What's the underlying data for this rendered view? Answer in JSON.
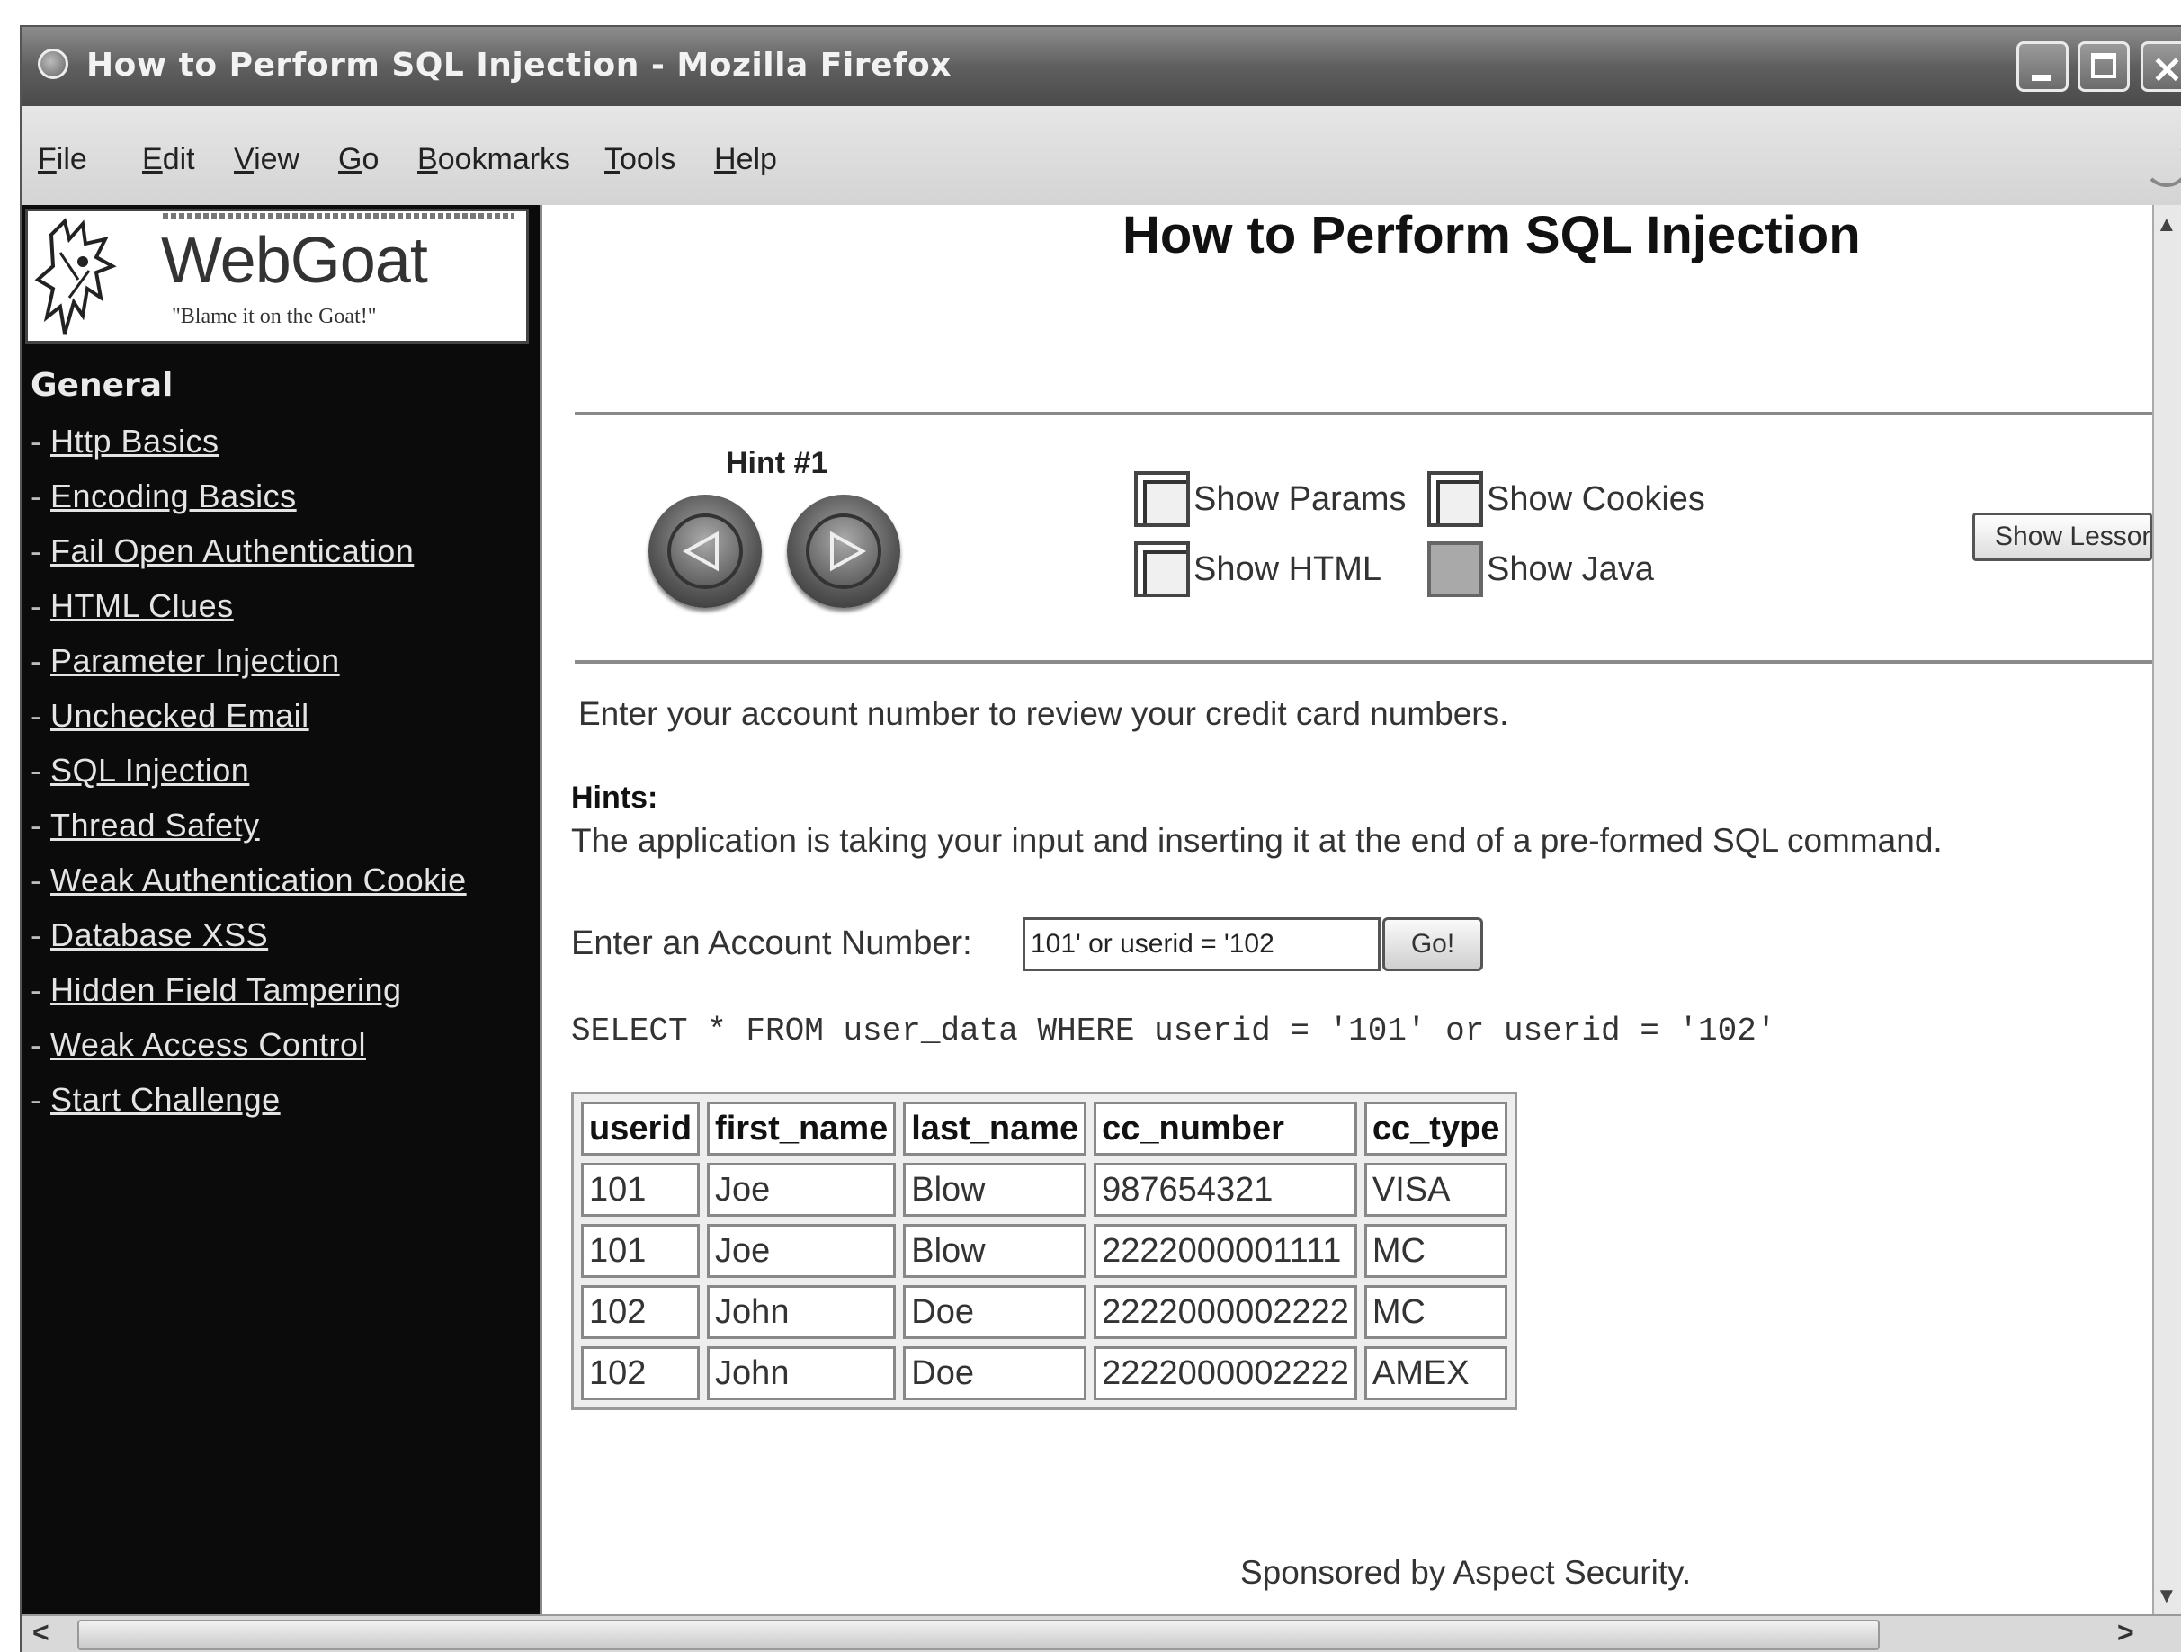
{
  "window": {
    "title": "How to Perform SQL Injection - Mozilla Firefox"
  },
  "menu": {
    "items": [
      {
        "first": "F",
        "rest": "ile"
      },
      {
        "first": "E",
        "rest": "dit"
      },
      {
        "first": "V",
        "rest": "iew"
      },
      {
        "first": "G",
        "rest": "o"
      },
      {
        "first": "B",
        "rest": "ookmarks"
      },
      {
        "first": "T",
        "rest": "ools"
      },
      {
        "first": "H",
        "rest": "elp"
      }
    ]
  },
  "logo": {
    "title": "WebGoat",
    "tagline": "\"Blame it on the Goat!\""
  },
  "sidebar": {
    "heading": "General",
    "items": [
      {
        "label": "Http Basics"
      },
      {
        "label": "Encoding Basics"
      },
      {
        "label": "Fail Open Authentication"
      },
      {
        "label": "HTML Clues"
      },
      {
        "label": "Parameter Injection"
      },
      {
        "label": "Unchecked Email"
      },
      {
        "label": "SQL Injection"
      },
      {
        "label": "Thread Safety"
      },
      {
        "label": "Weak Authentication Cookie"
      },
      {
        "label": "Database XSS"
      },
      {
        "label": "Hidden Field Tampering"
      },
      {
        "label": "Weak Access Control"
      },
      {
        "label": "Start Challenge"
      }
    ]
  },
  "main": {
    "title": "How to Perform SQL Injection",
    "hint_label": "Hint #1",
    "options": {
      "show_params": "Show Params",
      "show_cookies": "Show Cookies",
      "show_html": "Show HTML",
      "show_java": "Show Java"
    },
    "show_lesson": "Show Lesson Plan",
    "intro": "Enter your account number to review your credit card numbers.",
    "hints_label": "Hints:",
    "hints_text": "The application is taking your input and inserting it at the end of a pre-formed SQL command.",
    "account_label": "Enter an Account Number:",
    "account_value": "101' or userid = '102",
    "go_label": "Go!",
    "sql": "SELECT * FROM user_data WHERE userid = '101' or userid = '102'",
    "sponsor": "Sponsored by Aspect Security."
  },
  "results": {
    "columns": [
      "userid",
      "first_name",
      "last_name",
      "cc_number",
      "cc_type"
    ],
    "rows": [
      [
        "101",
        "Joe",
        "Blow",
        "987654321",
        "VISA"
      ],
      [
        "101",
        "Joe",
        "Blow",
        "2222000001111",
        "MC"
      ],
      [
        "102",
        "John",
        "Doe",
        "2222000002222",
        "MC"
      ],
      [
        "102",
        "John",
        "Doe",
        "2222000002222",
        "AMEX"
      ]
    ]
  }
}
